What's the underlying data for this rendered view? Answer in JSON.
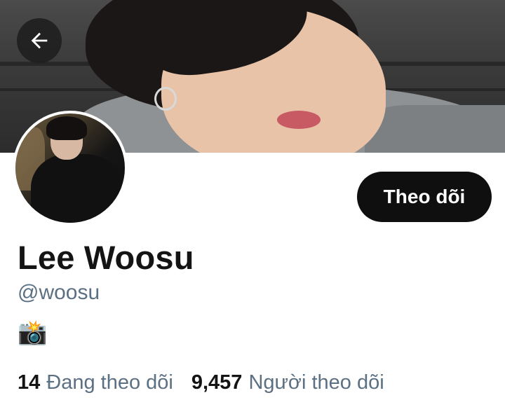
{
  "profile": {
    "name": "Lee Woosu",
    "handle": "@woosu",
    "bio_emoji": "📸",
    "follow_label": "Theo dõi"
  },
  "stats": {
    "following_count": "14",
    "following_label": "Đang theo dõi",
    "followers_count": "9,457",
    "followers_label": "Người theo dõi"
  },
  "icons": {
    "back": "arrow-left-icon"
  },
  "colors": {
    "text_primary": "#141414",
    "text_secondary": "#5b7083",
    "button_bg": "#0f0f0f",
    "button_text": "#ffffff"
  }
}
